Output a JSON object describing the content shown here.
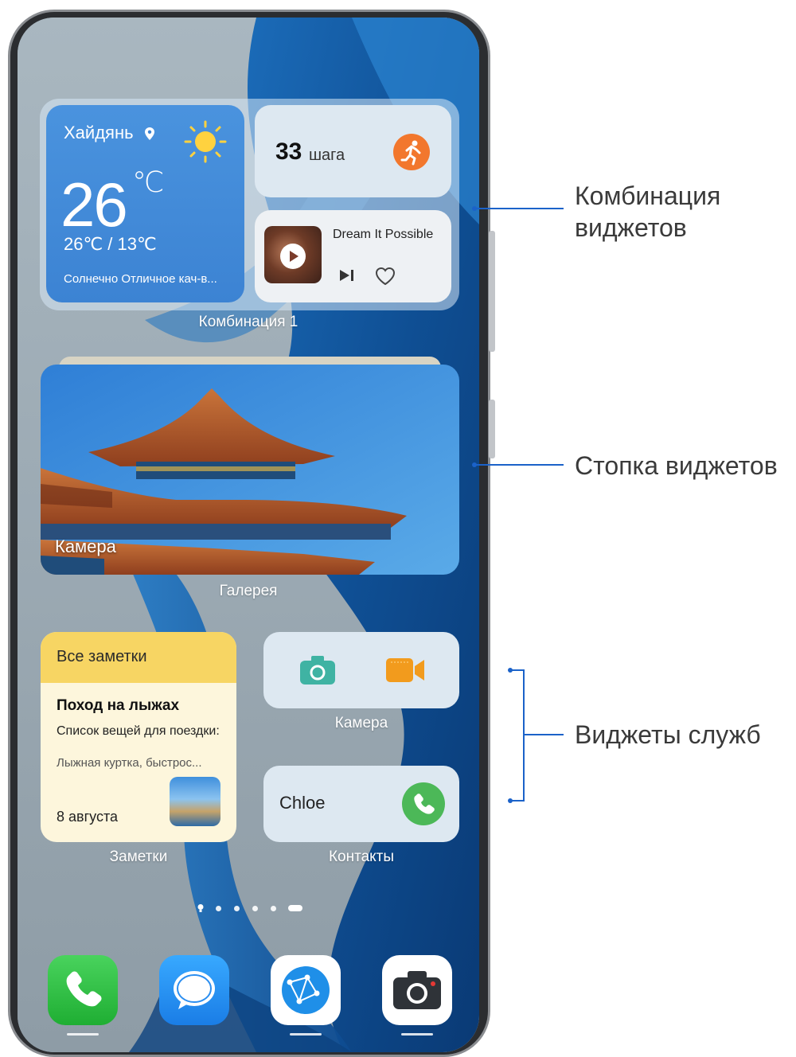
{
  "colors": {
    "annotation_line": "#1b62c9",
    "weather_bg": "#3c83d3",
    "notes_header": "#f7d563",
    "call_green": "#4cb858",
    "run_orange": "#f2772d"
  },
  "combination": {
    "weather": {
      "city": "Хайдянь",
      "temp": "26",
      "unit": "℃",
      "range": "26℃ / 13℃",
      "description": "Солнечно  Отличное кач-в..."
    },
    "steps": {
      "count": "33",
      "unit_label": "шага"
    },
    "music": {
      "title": "Dream It Possible"
    },
    "label": "Комбинация 1"
  },
  "stack": {
    "camera_label": "Камера",
    "label": "Галерея"
  },
  "notes": {
    "header": "Все заметки",
    "title": "Поход на лыжах",
    "body": "Список вещей для поездки:",
    "snippet": "Лыжная куртка, быстрос...",
    "date": "8 августа",
    "label": "Заметки"
  },
  "camera_service": {
    "label": "Камера"
  },
  "contacts": {
    "name": "Chloe",
    "label": "Контакты"
  },
  "page_indicator": {
    "pages": 6,
    "active_index": 5
  },
  "dock": [
    {
      "icon": "phone-icon"
    },
    {
      "icon": "messages-icon"
    },
    {
      "icon": "browser-icon"
    },
    {
      "icon": "camera-icon"
    }
  ],
  "annotations": {
    "combination": "Комбинация виджетов",
    "stack": "Стопка виджетов",
    "services": "Виджеты служб"
  }
}
